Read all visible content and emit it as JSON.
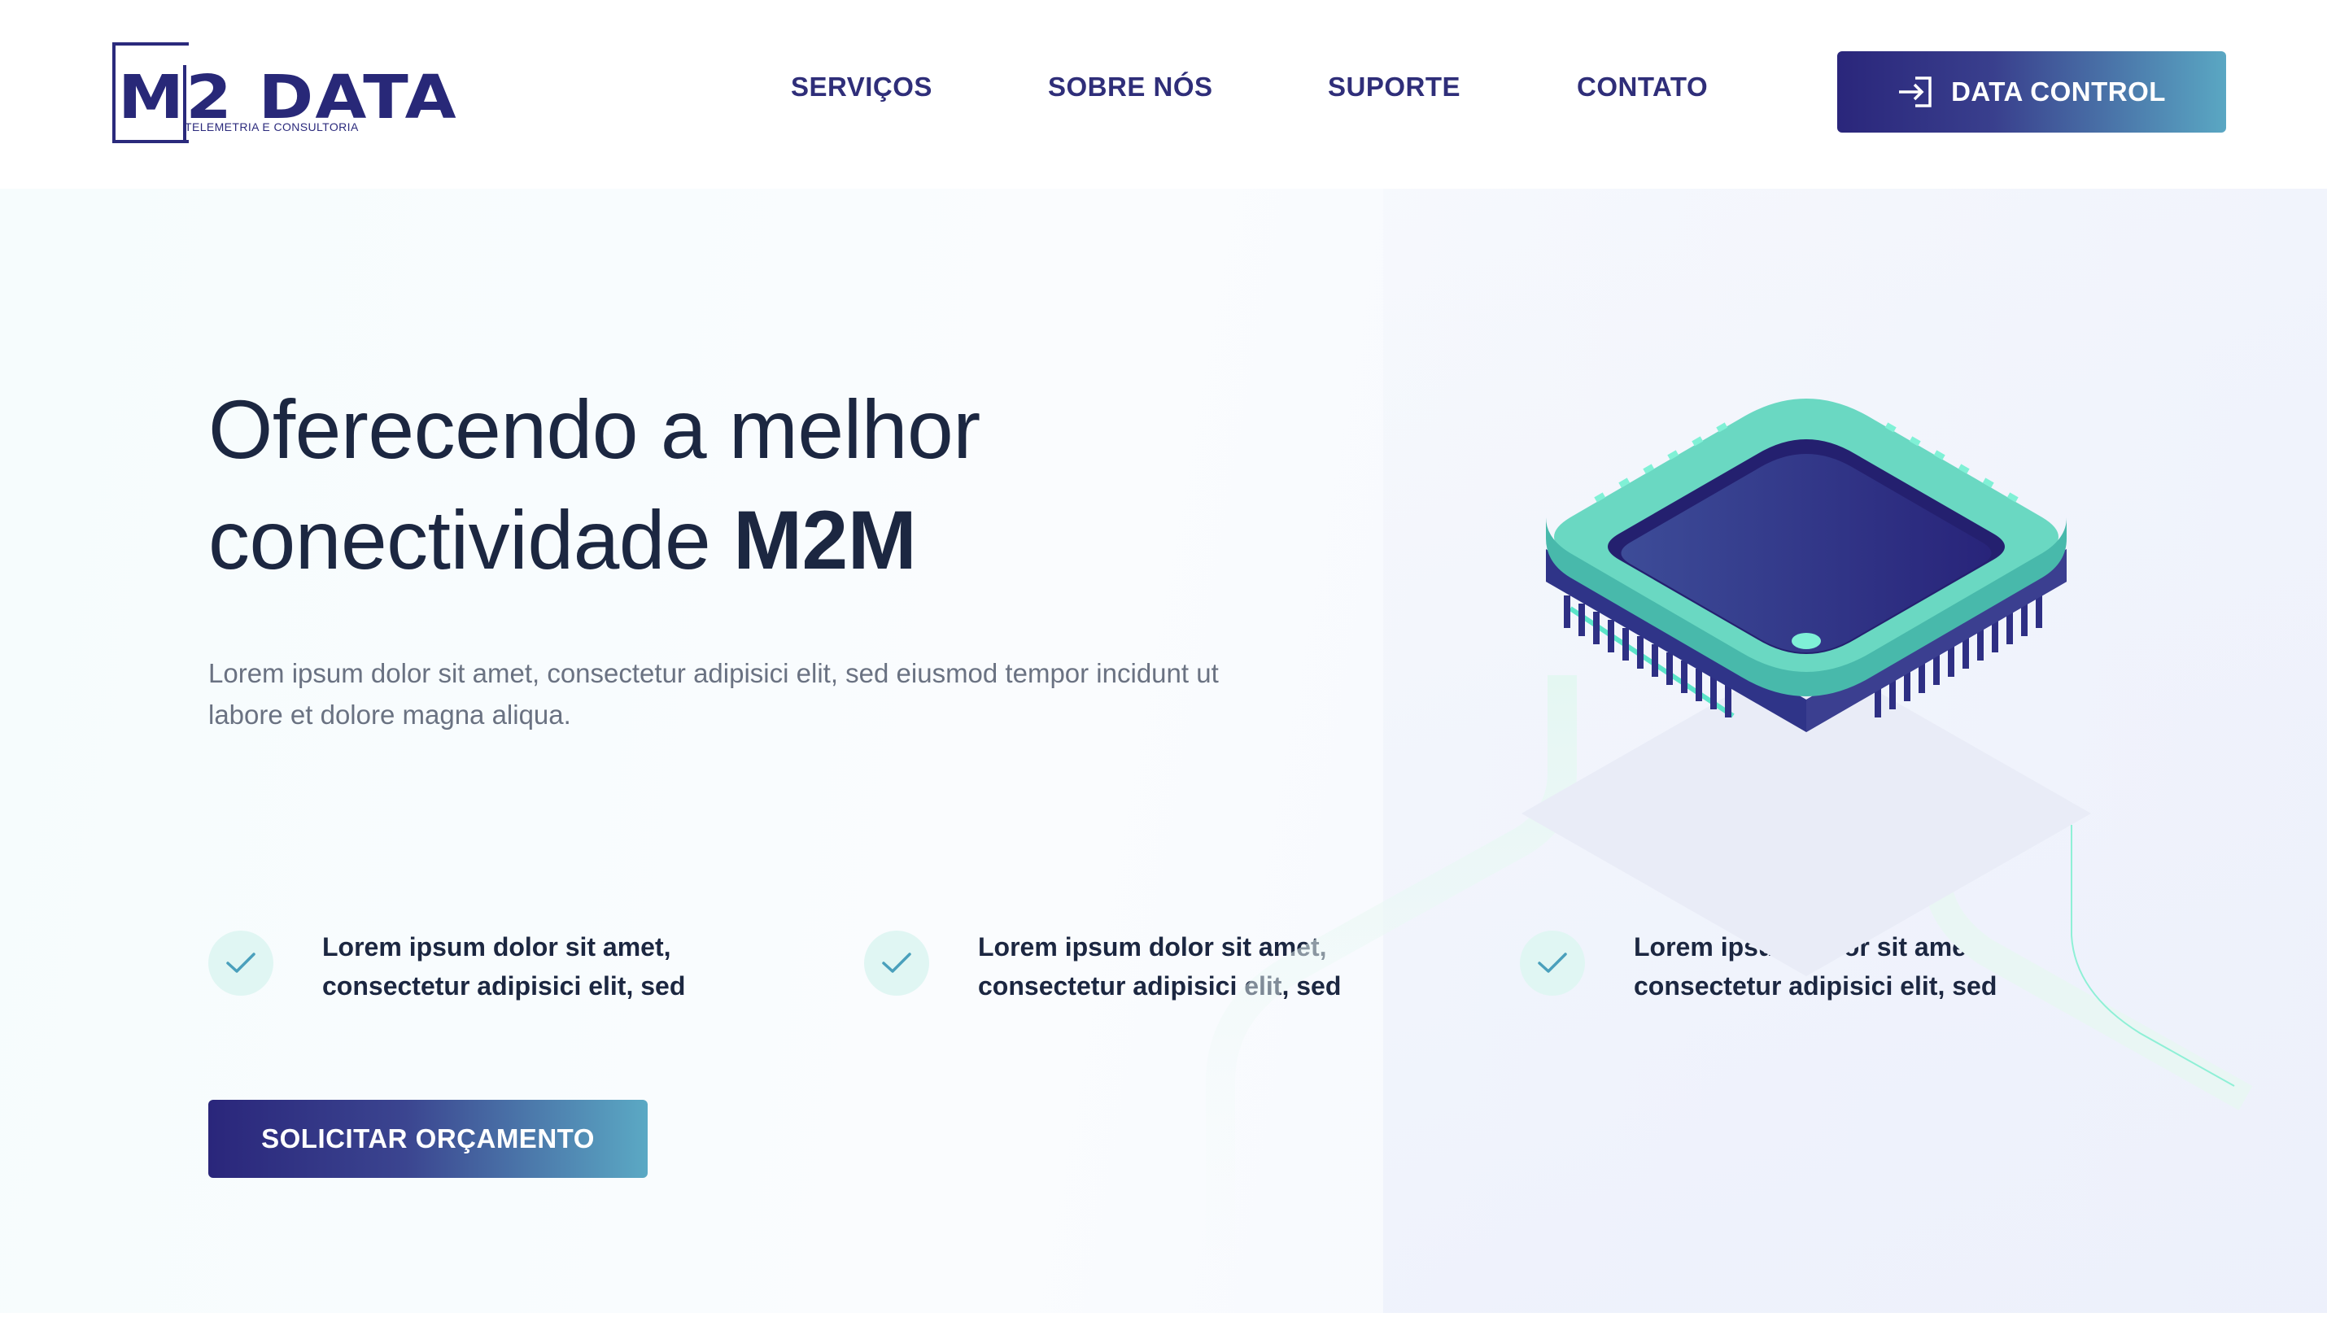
{
  "brand": {
    "name": "M2 DATA",
    "tagline": "TELEMETRIA E CONSULTORIA"
  },
  "nav": {
    "items": [
      {
        "label": "SERVIÇOS"
      },
      {
        "label": "SOBRE NÓS"
      },
      {
        "label": "SUPORTE"
      },
      {
        "label": "CONTATO"
      }
    ],
    "login_button": {
      "label": "DATA CONTROL",
      "icon": "login-icon"
    }
  },
  "hero": {
    "title_line1": "Oferecendo a melhor",
    "title_line2_regular": "conectividade ",
    "title_line2_bold": "M2M",
    "description": "Lorem ipsum dolor sit amet, consectetur adipisici elit, sed eiusmod tempor incidunt ut labore et dolore magna aliqua.",
    "illustration": "microchip-illustration"
  },
  "features": [
    {
      "icon": "check-icon",
      "line1": "Lorem ipsum dolor sit amet,",
      "line2": "consectetur adipisici elit, sed"
    },
    {
      "icon": "check-icon",
      "line1": "Lorem ipsum dolor sit amet,",
      "line2": "consectetur adipisici elit, sed"
    },
    {
      "icon": "check-icon",
      "line1": "Lorem ipsum dolor sit amet,",
      "line2": "consectetur adipisici elit, sed"
    }
  ],
  "cta": {
    "label": "SOLICITAR ORÇAMENTO"
  },
  "colors": {
    "brand_navy": "#2b2a7c",
    "text_dark": "#1c2741",
    "text_muted": "#6a7282",
    "accent_teal": "#5ecfb0",
    "gradient_end": "#5aa7c3",
    "check_bg": "#e0f6f3"
  }
}
